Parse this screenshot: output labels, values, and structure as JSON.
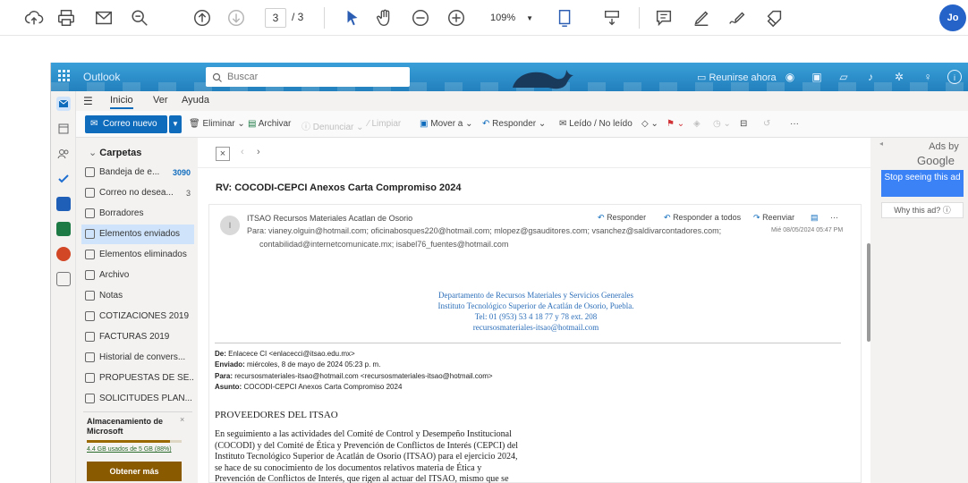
{
  "pdf_toolbar": {
    "page_current": "3",
    "page_total": "/ 3",
    "zoom": "109%",
    "user_initials": "Jo"
  },
  "outlook": {
    "app_name": "Outlook",
    "search_placeholder": "Buscar",
    "meet_now": "Reunirse ahora",
    "ribbon_tabs": [
      "Inicio",
      "Ver",
      "Ayuda"
    ],
    "new_mail": "Correo nuevo",
    "ribbon_actions": {
      "delete": "Eliminar",
      "archive": "Archivar",
      "report": "Denunciar",
      "sweep": "Limpiar",
      "move": "Mover a",
      "reply": "Responder",
      "read_unread": "Leído / No leído"
    },
    "folders_header": "Carpetas",
    "folders": [
      {
        "label": "Bandeja de e...",
        "count": "3090"
      },
      {
        "label": "Correo no desea...",
        "count": "3"
      },
      {
        "label": "Borradores",
        "count": ""
      },
      {
        "label": "Elementos enviados",
        "count": ""
      },
      {
        "label": "Elementos eliminados",
        "count": ""
      },
      {
        "label": "Archivo",
        "count": ""
      },
      {
        "label": "Notas",
        "count": ""
      },
      {
        "label": "COTIZACIONES 2019",
        "count": ""
      },
      {
        "label": "FACTURAS 2019",
        "count": ""
      },
      {
        "label": "Historial de convers...",
        "count": ""
      },
      {
        "label": "PROPUESTAS DE SE...",
        "count": ""
      },
      {
        "label": "SOLICITUDES PLAN...",
        "count": ""
      }
    ],
    "storage": {
      "title": "Almacenamiento de Microsoft",
      "usage": "4.4 GB usados de 5 GB (88%)",
      "usage_fraction": 0.88,
      "get_more": "Obtener más"
    }
  },
  "message": {
    "subject": "RV: COCODI-CEPCI Anexos Carta Compromiso 2024",
    "sender": "ITSAO Recursos Materiales Acatlan de Osorio",
    "to_label": "Para:",
    "to": "vianey.olguin@hotmail.com;  oficinabosques220@hotmail.com;  mlopez@gsauditores.com;  vsanchez@saldivarcontadores.com;",
    "cc": "contabilidad@internetcomunicate.mx;  isabel76_fuentes@hotmail.com",
    "date": "Mié 08/05/2024 05:47 PM",
    "actions": {
      "reply": "Responder",
      "reply_all": "Responder a todos",
      "forward": "Reenviar"
    },
    "signature": [
      "Departamento de Recursos Materiales y Servicios Generales",
      "Instituto Tecnológico Superior de Acatlán de Osorio, Puebla.",
      "Tel: 01 (953) 53 4 18 77 y 78  ext. 208",
      "recursosmateriales-itsao@hotmail.com"
    ],
    "fwd": {
      "from_label": "De:",
      "from": "Enlacece CI <enlacecci@itsao.edu.mx>",
      "sent_label": "Enviado:",
      "sent": "miércoles, 8 de mayo de 2024 05:23 p. m.",
      "to_label": "Para:",
      "to": "recursosmateriales-itsao@hotmail.com <recursosmateriales-itsao@hotmail.com>",
      "subject_label": "Asunto:",
      "subject": "COCODI-CEPCI Anexos Carta Compromiso 2024"
    },
    "body_title": "PROVEEDORES DEL ITSAO",
    "body_lines": [
      "En seguimiento a las actividades del Comité de Control y Desempeño Institucional",
      "(COCODI) y del Comité de Ética y Prevención de Conflictos de Interés (CEPCI) del",
      "Instituto Tecnológico Superior de Acatlán de Osorio (ITSAO) para el ejercicio 2024,",
      "se hace de su conocimiento de los documentos relativos materia de Ética y",
      "Prevención de Conflictos de Interés, que rigen al actuar del ITSAO, mismo que se"
    ]
  },
  "ad": {
    "ads_by": "Ads by",
    "google": "Google",
    "stop": "Stop seeing this ad",
    "why": "Why this ad? ⓘ"
  }
}
